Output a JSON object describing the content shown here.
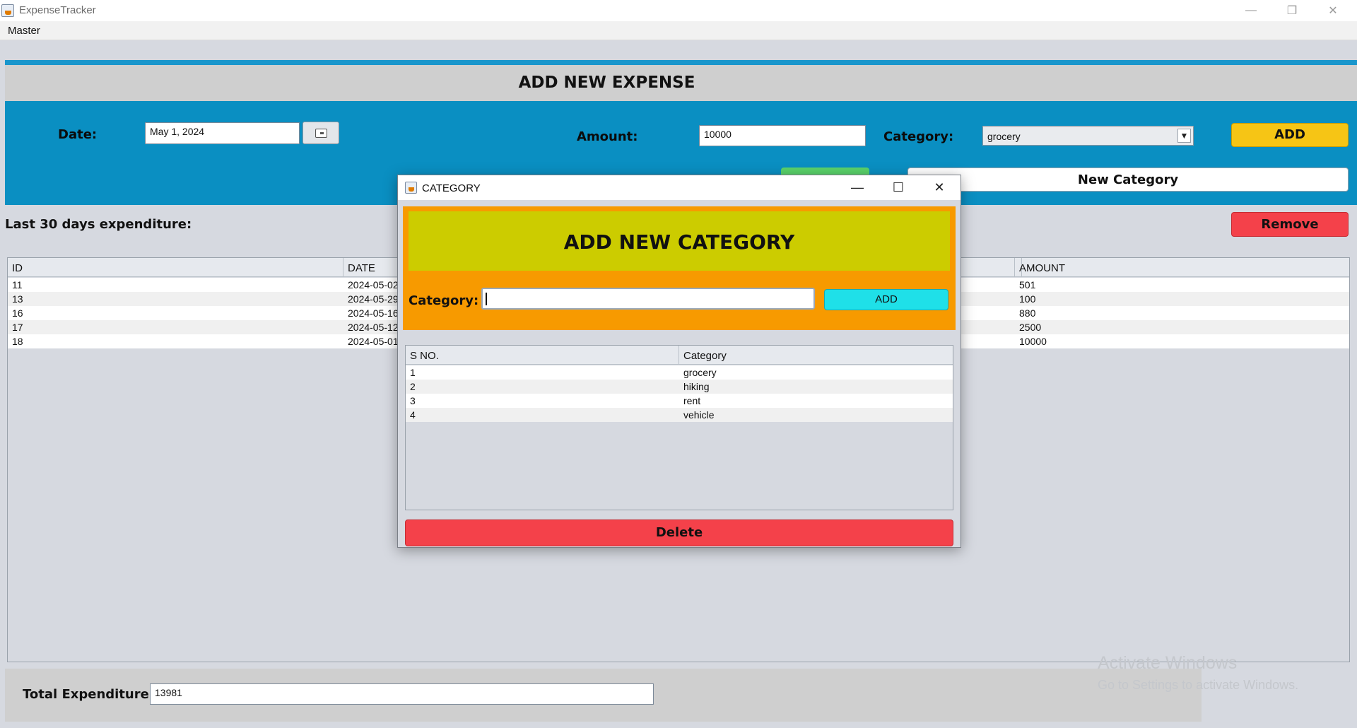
{
  "window": {
    "title": "ExpenseTracker"
  },
  "menu": {
    "items": [
      "Master"
    ]
  },
  "header": {
    "title": "ADD NEW EXPENSE"
  },
  "form": {
    "date_label": "Date:",
    "date_value": "May 1, 2024",
    "amount_label": "Amount:",
    "amount_value": "10000",
    "category_label": "Category:",
    "category_value": "grocery",
    "add_label": "ADD",
    "new_category_label": "New Category"
  },
  "expenses": {
    "title": "Last 30 days expenditure:",
    "remove_label": "Remove",
    "columns": [
      "ID",
      "DATE",
      "AMOUNT"
    ],
    "rows": [
      {
        "id": "11",
        "date": "2024-05-02",
        "amount": "501"
      },
      {
        "id": "13",
        "date": "2024-05-29",
        "amount": "100"
      },
      {
        "id": "16",
        "date": "2024-05-16",
        "amount": "880"
      },
      {
        "id": "17",
        "date": "2024-05-12",
        "amount": "2500"
      },
      {
        "id": "18",
        "date": "2024-05-01",
        "amount": "10000"
      }
    ]
  },
  "total": {
    "label": "Total Expenditure:",
    "value": "13981"
  },
  "watermark": {
    "line1": "Activate Windows",
    "line2": "Go to Settings to activate Windows."
  },
  "dialog": {
    "title": "CATEGORY",
    "heading": "ADD NEW CATEGORY",
    "category_label": "Category:",
    "input_value": "",
    "add_label": "ADD",
    "columns": [
      "S NO.",
      "Category"
    ],
    "rows": [
      {
        "sno": "1",
        "category": "grocery"
      },
      {
        "sno": "2",
        "category": "hiking"
      },
      {
        "sno": "3",
        "category": "rent"
      },
      {
        "sno": "4",
        "category": "vehicle"
      }
    ],
    "delete_label": "Delete"
  },
  "colors": {
    "form_panel": "#0a8fc2",
    "add_button": "#f6c515",
    "remove_button": "#f4414a",
    "dialog_orange": "#f79a00",
    "dialog_yellow": "#cccc00",
    "dialog_add": "#1fe0e8"
  },
  "icons": [
    "app-icon",
    "minimize-icon",
    "maximize-icon",
    "close-icon",
    "calendar-icon",
    "chevron-down-icon"
  ]
}
